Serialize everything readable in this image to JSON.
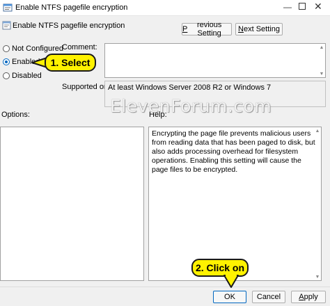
{
  "window": {
    "title": "Enable NTFS pagefile encryption",
    "minimize": "—",
    "close": "✕"
  },
  "header": {
    "setting_title": "Enable NTFS pagefile encryption"
  },
  "nav": {
    "previous_label": "Previous Setting",
    "previous_accesskey": "P",
    "next_label": "Next Setting",
    "next_accesskey": "N"
  },
  "state": {
    "options": [
      {
        "label": "Not Configured",
        "accesskey": "C",
        "checked": false
      },
      {
        "label": "Enabled",
        "accesskey": "E",
        "checked": true
      },
      {
        "label": "Disabled",
        "accesskey": "D",
        "checked": false
      }
    ]
  },
  "comment": {
    "label": "Comment:",
    "value": ""
  },
  "supported": {
    "label": "Supported on:",
    "value": "At least Windows Server 2008 R2 or Windows 7"
  },
  "options_pane": {
    "label": "Options:"
  },
  "help_pane": {
    "label": "Help:",
    "text": "Encrypting the page file prevents malicious users from reading data that has been paged to disk, but also adds processing overhead for filesystem operations.  Enabling this setting will cause the page files to be encrypted."
  },
  "footer": {
    "ok_label": "OK",
    "cancel_label": "Cancel",
    "apply_label": "Apply",
    "apply_accesskey": "A"
  },
  "annotations": {
    "watermark": "ElevenForum.com",
    "callout_select": "1. Select",
    "callout_click": "2. Click on",
    "callout_color": "#fff200"
  }
}
